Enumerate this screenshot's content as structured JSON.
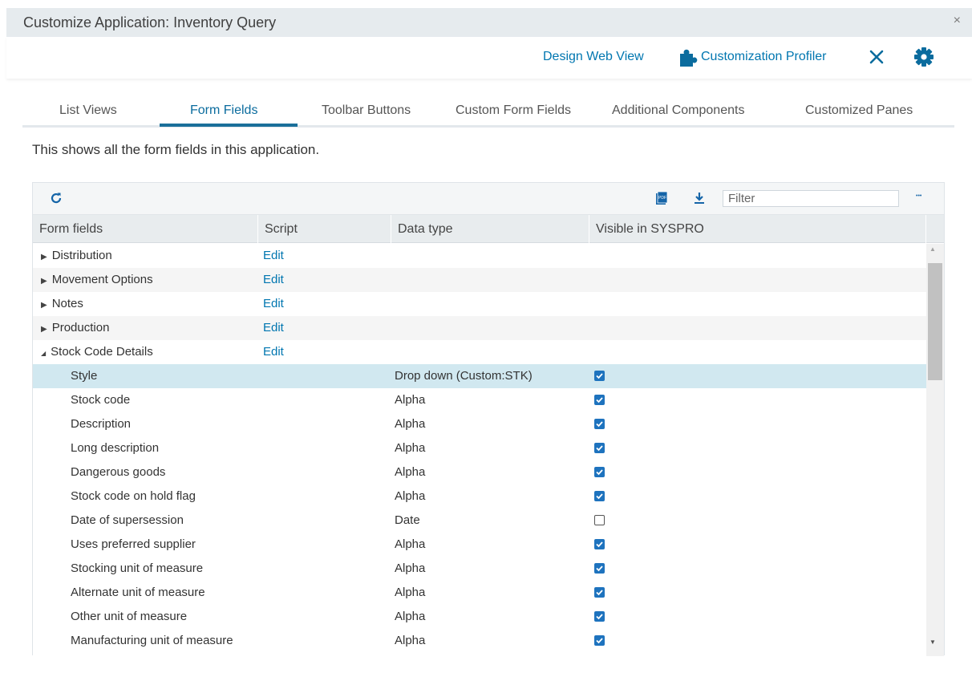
{
  "window": {
    "title": "Customize Application: Inventory Query",
    "close_glyph": "×"
  },
  "actions": {
    "design_web_view": "Design Web View",
    "customization_profiler": "Customization Profiler",
    "icons": [
      "puzzle-piece-icon",
      "close-x-icon",
      "gear-icon"
    ]
  },
  "tabs": [
    {
      "label": "List Views",
      "active": false
    },
    {
      "label": "Form Fields",
      "active": true
    },
    {
      "label": "Toolbar Buttons",
      "active": false
    },
    {
      "label": "Custom Form Fields",
      "active": false
    },
    {
      "label": "Additional Components",
      "active": false
    },
    {
      "label": "Customized Panes",
      "active": false
    }
  ],
  "description": "This shows all the form fields in this application.",
  "grid": {
    "toolbar": {
      "refresh_icon": "refresh-icon",
      "pdf_icon": "pdf-export-icon",
      "download_icon": "download-icon",
      "filter_placeholder": "Filter",
      "more_glyph": "•••"
    },
    "columns": [
      "Form fields",
      "Script",
      "Data type",
      "Visible in SYSPRO"
    ],
    "groups": [
      {
        "label": "Distribution",
        "expanded": false,
        "script": "Edit"
      },
      {
        "label": "Movement Options",
        "expanded": false,
        "script": "Edit"
      },
      {
        "label": "Notes",
        "expanded": false,
        "script": "Edit"
      },
      {
        "label": "Production",
        "expanded": false,
        "script": "Edit"
      },
      {
        "label": "Stock Code Details",
        "expanded": true,
        "script": "Edit"
      }
    ],
    "fields": [
      {
        "label": "Style",
        "type": "Drop down (Custom:STK)",
        "visible": true,
        "selected": true
      },
      {
        "label": "Stock code",
        "type": "Alpha",
        "visible": true
      },
      {
        "label": "Description",
        "type": "Alpha",
        "visible": true
      },
      {
        "label": "Long description",
        "type": "Alpha",
        "visible": true
      },
      {
        "label": "Dangerous goods",
        "type": "Alpha",
        "visible": true
      },
      {
        "label": "Stock code on hold flag",
        "type": "Alpha",
        "visible": true
      },
      {
        "label": "Date of supersession",
        "type": "Date",
        "visible": false
      },
      {
        "label": "Uses preferred supplier",
        "type": "Alpha",
        "visible": true
      },
      {
        "label": "Stocking unit of measure",
        "type": "Alpha",
        "visible": true
      },
      {
        "label": "Alternate unit of measure",
        "type": "Alpha",
        "visible": true
      },
      {
        "label": "Other unit of measure",
        "type": "Alpha",
        "visible": true
      },
      {
        "label": "Manufacturing unit of measure",
        "type": "Alpha",
        "visible": true
      }
    ],
    "glyphs": {
      "collapsed": "▶",
      "expanded": "◢",
      "scroll_up": "▲",
      "scroll_down": "▼"
    }
  },
  "colors": {
    "accent": "#0076b0",
    "tab_underline": "#1a6f9a",
    "selected_row": "#d1e8f0",
    "checkbox": "#1e73be"
  }
}
